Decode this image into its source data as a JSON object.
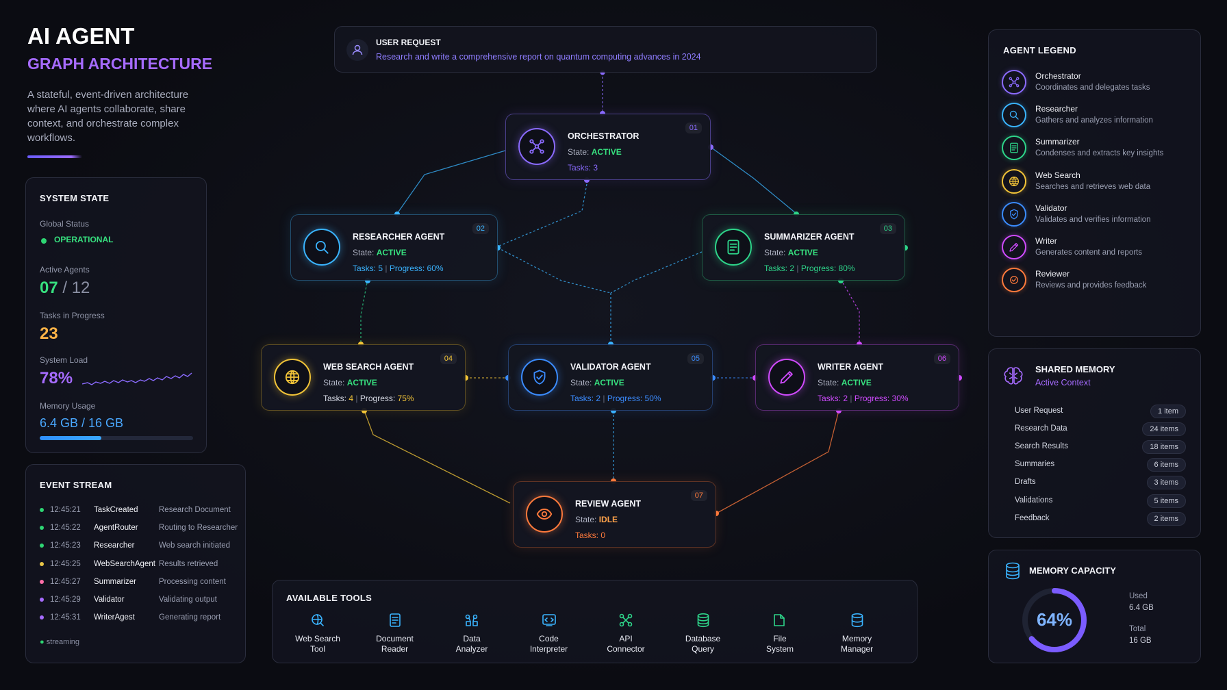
{
  "header": {
    "title": "AI AGENT",
    "subtitle": "GRAPH ARCHITECTURE",
    "description": "A stateful, event-driven architecture where AI agents collaborate, share context, and orchestrate complex workflows."
  },
  "system_state": {
    "title": "SYSTEM STATE",
    "global_status_label": "Global Status",
    "global_status": "OPERATIONAL",
    "active_agents_label": "Active Agents",
    "active_agents": "07",
    "total_agents": "/ 12",
    "tasks_label": "Tasks in Progress",
    "tasks": "23",
    "load_label": "System Load",
    "load": "78%",
    "memory_label": "Memory Usage",
    "memory": "6.4 GB / 16 GB",
    "memory_fraction": 0.4
  },
  "event_stream": {
    "title": "EVENT STREAM",
    "events": [
      {
        "time": "12:45:21",
        "name": "TaskCreated",
        "desc": "Research Document",
        "color": "#2ed573"
      },
      {
        "time": "12:45:22",
        "name": "AgentRouter",
        "desc": "Routing to Researcher",
        "color": "#2ed573"
      },
      {
        "time": "12:45:23",
        "name": "Researcher",
        "desc": "Web search initiated",
        "color": "#2ed573"
      },
      {
        "time": "12:45:25",
        "name": "WebSearchAgent",
        "desc": "Results retrieved",
        "color": "#e8c547"
      },
      {
        "time": "12:45:27",
        "name": "Summarizer",
        "desc": "Processing content",
        "color": "#ff6fa8"
      },
      {
        "time": "12:45:29",
        "name": "Validator",
        "desc": "Validating output",
        "color": "#a66bff"
      },
      {
        "time": "12:45:31",
        "name": "WriterAgest",
        "desc": "Generating report",
        "color": "#a66bff"
      }
    ],
    "footer": "streaming"
  },
  "user_request": {
    "title": "USER REQUEST",
    "text": "Research and write a comprehensive report on quantum computing advances in 2024"
  },
  "agents": {
    "orchestrator": {
      "name": "ORCHESTRATOR",
      "state_label": "State:",
      "state": "ACTIVE",
      "tasks_label": "Tasks:",
      "tasks": "3",
      "num": "01",
      "color": "#8b6bff",
      "icon": "network-icon"
    },
    "researcher": {
      "name": "RESEARCHER AGENT",
      "state_label": "State:",
      "state": "ACTIVE",
      "tasks_label": "Tasks:",
      "tasks": "5",
      "progress_label": "Progress:",
      "progress": "60%",
      "num": "02",
      "color": "#3ab4ff",
      "icon": "search-icon"
    },
    "summarizer": {
      "name": "SUMMARIZER AGENT",
      "state_label": "State:",
      "state": "ACTIVE",
      "tasks_label": "Tasks:",
      "tasks": "2",
      "progress_label": "Progress:",
      "progress": "80%",
      "num": "03",
      "color": "#2ed58a",
      "icon": "document-icon"
    },
    "websearch": {
      "name": "WEB SEARCH AGENT",
      "state_label": "State:",
      "state": "ACTIVE",
      "tasks_label": "Tasks:",
      "tasks": "4",
      "progress_label": "Progress:",
      "progress": "75%",
      "num": "04",
      "color": "#f2c438",
      "icon": "globe-icon"
    },
    "validator": {
      "name": "VALIDATOR AGENT",
      "state_label": "State:",
      "state": "ACTIVE",
      "tasks_label": "Tasks:",
      "tasks": "2",
      "progress_label": "Progress:",
      "progress": "50%",
      "num": "05",
      "color": "#3b8cff",
      "icon": "shield-icon"
    },
    "writer": {
      "name": "WRITER AGENT",
      "state_label": "State:",
      "state": "ACTIVE",
      "tasks_label": "Tasks:",
      "tasks": "2",
      "progress_label": "Progress:",
      "progress": "30%",
      "num": "06",
      "color": "#d04bff",
      "icon": "pencil-icon"
    },
    "review": {
      "name": "REVIEW AGENT",
      "state_label": "State:",
      "state": "IDLE",
      "tasks_label": "Tasks:",
      "tasks": "0",
      "num": "07",
      "color": "#ff7a3c",
      "icon": "eye-icon"
    }
  },
  "legend": {
    "title": "AGENT LEGEND",
    "items": [
      {
        "name": "Orchestrator",
        "desc": "Coordinates and delegates tasks",
        "color": "#8b6bff",
        "icon": "network-icon"
      },
      {
        "name": "Researcher",
        "desc": "Gathers and analyzes information",
        "color": "#3ab4ff",
        "icon": "search-icon"
      },
      {
        "name": "Summarizer",
        "desc": "Condenses and extracts key insights",
        "color": "#2ed58a",
        "icon": "document-icon"
      },
      {
        "name": "Web Search",
        "desc": "Searches and retrieves web data",
        "color": "#f2c438",
        "icon": "globe-icon"
      },
      {
        "name": "Validator",
        "desc": "Validates and verifies information",
        "color": "#3b8cff",
        "icon": "shield-icon"
      },
      {
        "name": "Writer",
        "desc": "Generates content and reports",
        "color": "#d04bff",
        "icon": "pencil-icon"
      },
      {
        "name": "Reviewer",
        "desc": "Reviews and provides feedback",
        "color": "#ff7a3c",
        "icon": "check-icon"
      }
    ]
  },
  "shared_memory": {
    "title": "SHARED MEMORY",
    "subtitle": "Active Context",
    "rows": [
      {
        "key": "User Request",
        "value": "1 item"
      },
      {
        "key": "Research Data",
        "value": "24 items"
      },
      {
        "key": "Search Results",
        "value": "18 items"
      },
      {
        "key": "Summaries",
        "value": "6 items"
      },
      {
        "key": "Drafts",
        "value": "3 items"
      },
      {
        "key": "Validations",
        "value": "5 items"
      },
      {
        "key": "Feedback",
        "value": "2 items"
      }
    ]
  },
  "memory_capacity": {
    "title": "MEMORY CAPACITY",
    "percent": "64%",
    "fraction": 0.64,
    "used_label": "Used",
    "used": "6.4 GB",
    "total_label": "Total",
    "total": "16 GB"
  },
  "tools": {
    "title": "AVAILABLE TOOLS",
    "items": [
      {
        "line1": "Web Search",
        "line2": "Tool",
        "color": "#3ab4ff",
        "icon": "web-search-tool-icon"
      },
      {
        "line1": "Document",
        "line2": "Reader",
        "color": "#3ab4ff",
        "icon": "document-icon"
      },
      {
        "line1": "Data",
        "line2": "Analyzer",
        "color": "#3ab4ff",
        "icon": "data-icon"
      },
      {
        "line1": "Code",
        "line2": "Interpreter",
        "color": "#3ab4ff",
        "icon": "code-icon"
      },
      {
        "line1": "API",
        "line2": "Connector",
        "color": "#2ed58a",
        "icon": "api-icon"
      },
      {
        "line1": "Database",
        "line2": "Query",
        "color": "#2ed58a",
        "icon": "database-icon"
      },
      {
        "line1": "File",
        "line2": "System",
        "color": "#2ed58a",
        "icon": "folder-icon"
      },
      {
        "line1": "Memory",
        "line2": "Manager",
        "color": "#3ab4ff",
        "icon": "memory-icon"
      }
    ]
  }
}
